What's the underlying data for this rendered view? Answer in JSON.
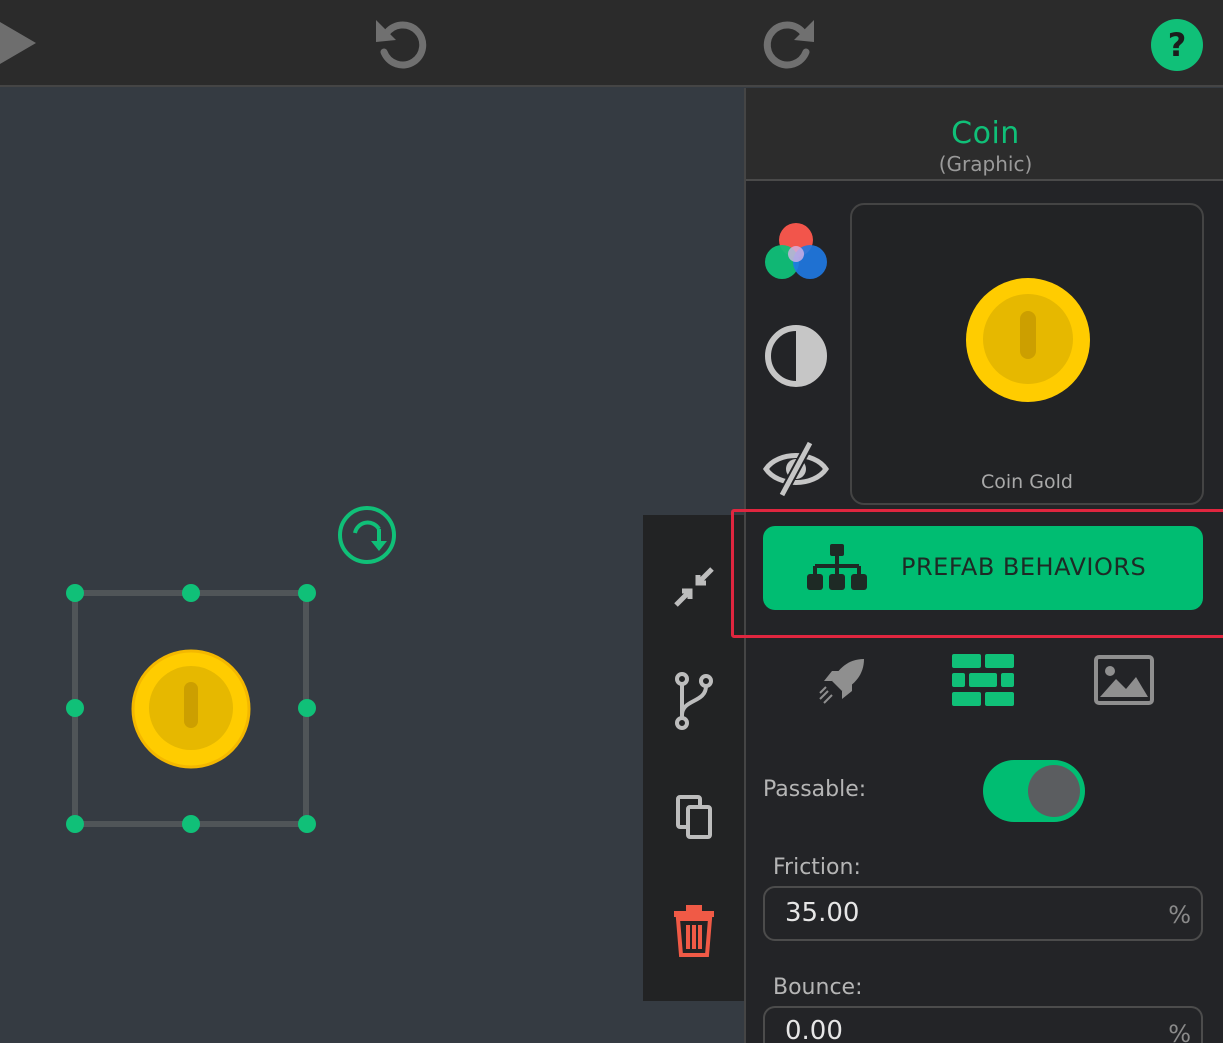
{
  "topbar": {
    "play_icon": "play-icon",
    "undo_icon": "undo-icon",
    "redo_icon": "redo-icon",
    "help_icon": "help-icon",
    "help_color": "#10c078"
  },
  "inspector": {
    "title": "Coin",
    "subtitle": "(Graphic)",
    "preview_label": "Coin Gold",
    "side_icons": [
      "color-palette-icon",
      "contrast-icon",
      "visibility-off-icon"
    ],
    "prefab_button_label": "PREFAB BEHAVIORS",
    "tabs": [
      "rocket-icon",
      "bricks-icon",
      "image-icon"
    ],
    "passable_label": "Passable:",
    "passable_on": true,
    "friction_label": "Friction:",
    "friction_value": "35.00",
    "friction_unit": "%",
    "bounce_label": "Bounce:",
    "bounce_value": "0.00",
    "bounce_unit": "%"
  },
  "tools": [
    "shrink-icon",
    "branch-icon",
    "copy-icon",
    "trash-icon"
  ],
  "colors": {
    "accent": "#00bd72",
    "danger": "#f05a46",
    "highlight": "#e0263f",
    "coin": "#ffcc00"
  }
}
